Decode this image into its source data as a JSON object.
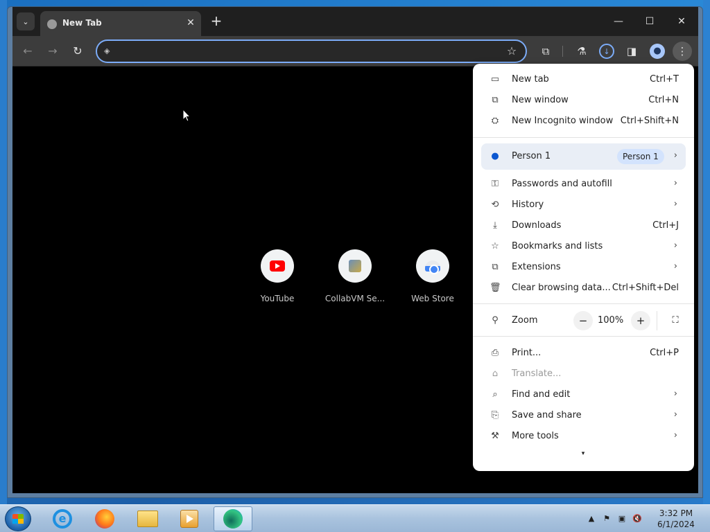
{
  "tab": {
    "title": "New Tab",
    "close": "✕"
  },
  "tabstrip": {
    "new_tab": "+"
  },
  "window_controls": {
    "minimize": "—",
    "maximize": "☐",
    "close": "✕"
  },
  "toolbar": {
    "back": "←",
    "forward": "→",
    "reload": "↻",
    "omnibox_value": "",
    "omnibox_placeholder": "",
    "extensions": "⧉",
    "labs": "⚗",
    "download": "↓",
    "side_panel": "◨",
    "profile": "●",
    "menu": "⋮"
  },
  "shortcuts": [
    {
      "label": "YouTube",
      "icon": "youtube-icon"
    },
    {
      "label": "CollabVM Se...",
      "icon": "collabvm-icon"
    },
    {
      "label": "Web Store",
      "icon": "web-store-icon"
    }
  ],
  "menu": {
    "items_top": [
      {
        "icon": "▭",
        "label": "New tab",
        "shortcut": "Ctrl+T"
      },
      {
        "icon": "⧉",
        "label": "New window",
        "shortcut": "Ctrl+N"
      },
      {
        "icon": "⛭",
        "label": "New Incognito window",
        "shortcut": "Ctrl+Shift+N"
      }
    ],
    "person": {
      "label": "Person 1",
      "badge": "Person 1",
      "arrow": "›"
    },
    "items_mid": [
      {
        "icon": "⚿",
        "label": "Passwords and autofill",
        "arrow": "›"
      },
      {
        "icon": "⟲",
        "label": "History",
        "arrow": "›"
      },
      {
        "icon": "⤓",
        "label": "Downloads",
        "shortcut": "Ctrl+J"
      },
      {
        "icon": "☆",
        "label": "Bookmarks and lists",
        "arrow": "›"
      },
      {
        "icon": "⧉",
        "label": "Extensions",
        "arrow": "›"
      },
      {
        "icon": "🗑",
        "label": "Clear browsing data...",
        "shortcut": "Ctrl+Shift+Del"
      }
    ],
    "zoom": {
      "label": "Zoom",
      "minus": "−",
      "value": "100%",
      "plus": "+",
      "fullscreen": "⛶",
      "icon": "⚲"
    },
    "items_bottom": [
      {
        "icon": "⎙",
        "label": "Print...",
        "shortcut": "Ctrl+P"
      },
      {
        "icon": "⌂",
        "label": "Translate...",
        "disabled": true
      },
      {
        "icon": "⌕",
        "label": "Find and edit",
        "arrow": "›"
      },
      {
        "icon": "⎘",
        "label": "Save and share",
        "arrow": "›"
      },
      {
        "icon": "⚒",
        "label": "More tools",
        "arrow": "›"
      }
    ],
    "more_caret": "▾"
  },
  "taskbar": {
    "tray": {
      "show_hidden": "▲",
      "flag": "⚑",
      "network": "▣",
      "volume": "🔇"
    },
    "clock": {
      "time": "3:32 PM",
      "date": "6/1/2024"
    }
  }
}
